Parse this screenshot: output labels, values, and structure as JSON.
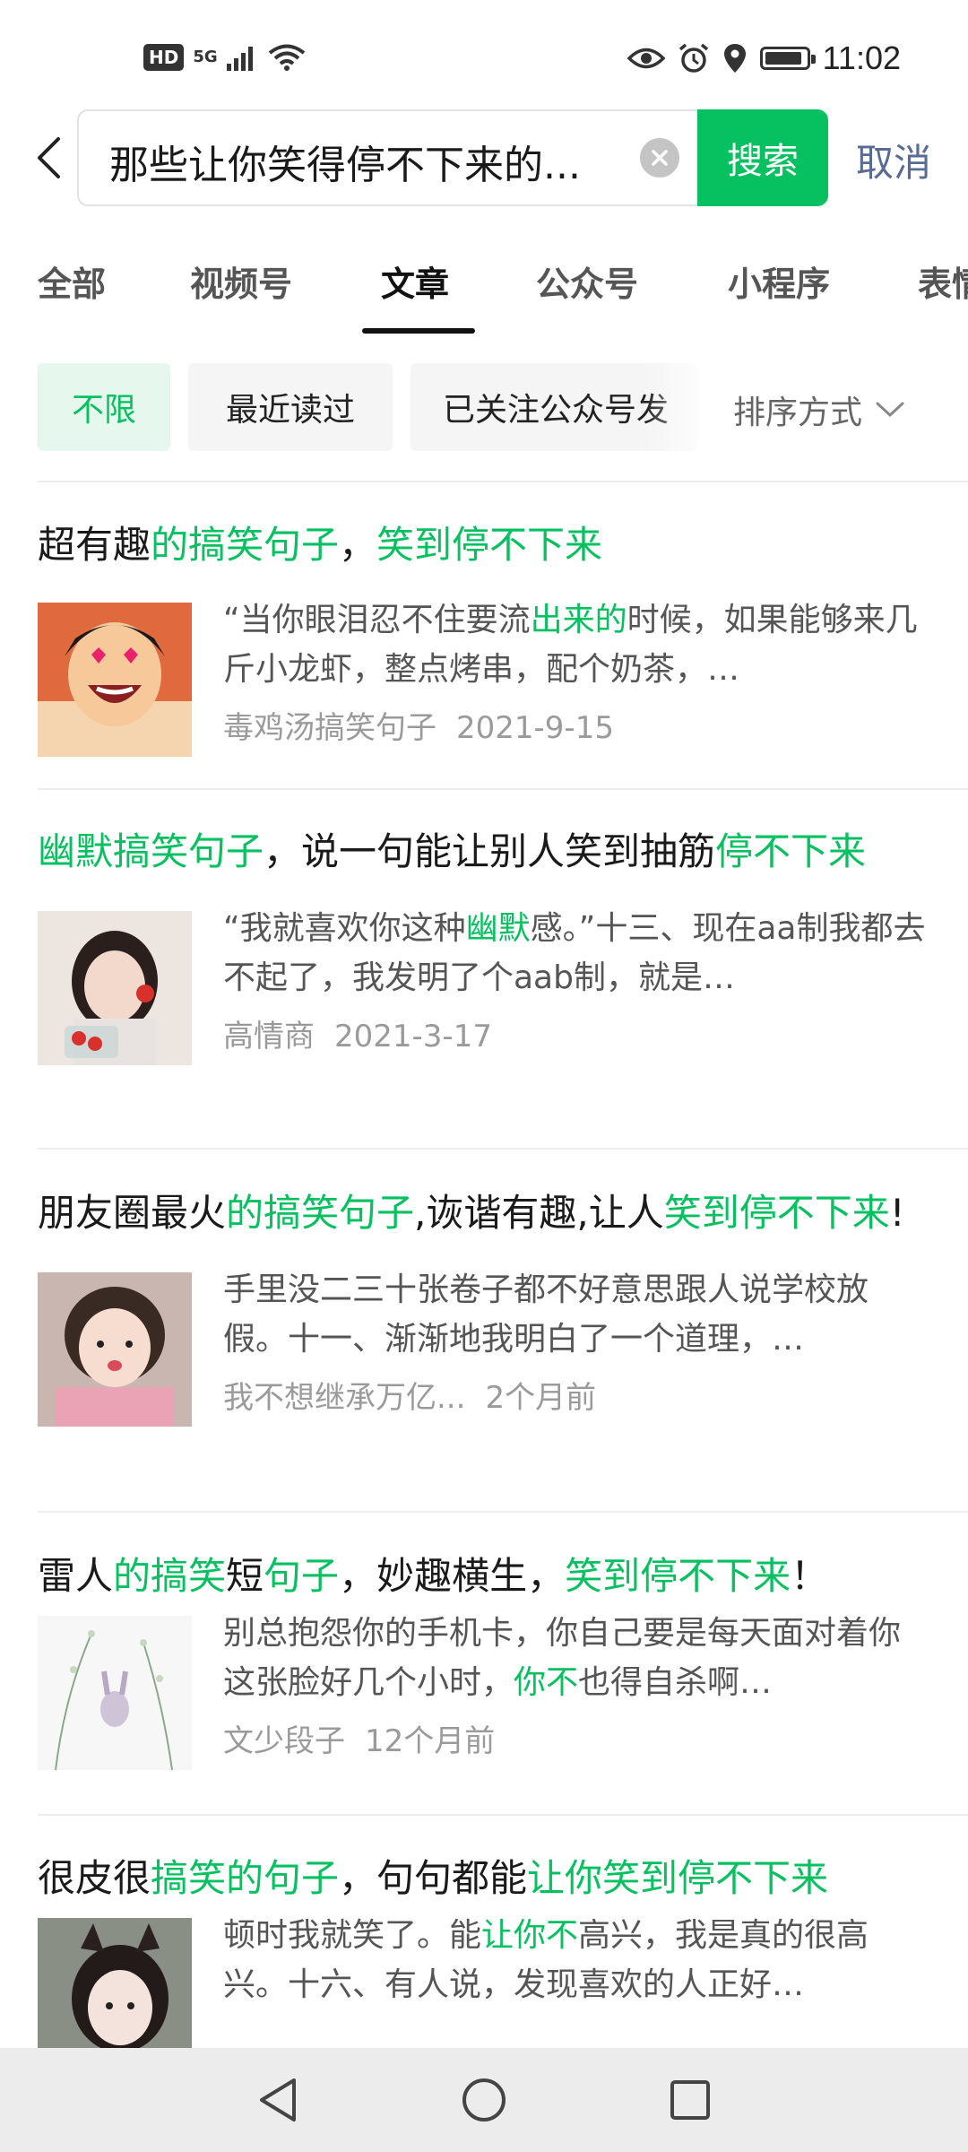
{
  "status_bar": {
    "hd": "HD",
    "network": "5G",
    "time": "11:02",
    "battery_level": 0.9
  },
  "search": {
    "query": "那些让你笑得停不下来的...",
    "button_label": "搜索",
    "cancel_label": "取消"
  },
  "tabs": [
    {
      "label": "全部"
    },
    {
      "label": "视频号"
    },
    {
      "label": "文章"
    },
    {
      "label": "公众号"
    },
    {
      "label": "小程序"
    },
    {
      "label": "表情"
    }
  ],
  "filters": {
    "chips": [
      {
        "label": "不限"
      },
      {
        "label": "最近读过"
      },
      {
        "label": "已关注公众号发"
      }
    ],
    "sort_label": "排序方式"
  },
  "results": [
    {
      "title": [
        {
          "t": "超有趣",
          "h": false
        },
        {
          "t": "的搞笑句子",
          "h": true
        },
        {
          "t": "，",
          "h": false
        },
        {
          "t": "笑到停不下来",
          "h": true
        }
      ],
      "snippet": [
        {
          "t": "“当你眼泪忍不住要流",
          "h": false
        },
        {
          "t": "出来的",
          "h": true
        },
        {
          "t": "时候，如果能够来几斤小龙虾，整点烤串，配个奶茶，…",
          "h": false
        }
      ],
      "source": "毒鸡汤搞笑句子",
      "date": "2021-9-15"
    },
    {
      "title": [
        {
          "t": "幽默搞笑句子",
          "h": true
        },
        {
          "t": "，说一句能让别人笑到抽筋",
          "h": false
        },
        {
          "t": "停不下来",
          "h": true
        }
      ],
      "snippet": [
        {
          "t": "“我就喜欢你这种",
          "h": false
        },
        {
          "t": "幽默",
          "h": true
        },
        {
          "t": "感。”十三、现在aa制我都去不起了，我发明了个aab制，就是…",
          "h": false
        }
      ],
      "source": "高情商",
      "date": "2021-3-17"
    },
    {
      "title": [
        {
          "t": "朋友圈最火",
          "h": false
        },
        {
          "t": "的搞笑句子",
          "h": true
        },
        {
          "t": ",诙谐有趣,让人",
          "h": false
        },
        {
          "t": "笑到停不下来",
          "h": true
        },
        {
          "t": "!",
          "h": false
        }
      ],
      "snippet": [
        {
          "t": "手里没二三十张卷子都不好意思跟人说学校放假。十一、渐渐地我明白了一个道理，…",
          "h": false
        }
      ],
      "source": "我不想继承万亿...",
      "date": "2个月前"
    },
    {
      "title": [
        {
          "t": "雷人",
          "h": false
        },
        {
          "t": "的搞笑",
          "h": true
        },
        {
          "t": "短",
          "h": false
        },
        {
          "t": "句子",
          "h": true
        },
        {
          "t": "，妙趣横生，",
          "h": false
        },
        {
          "t": "笑到停不下来",
          "h": true
        },
        {
          "t": "！",
          "h": false
        }
      ],
      "snippet": [
        {
          "t": "别总抱怨你的手机卡，你自己要是每天面对着你这张脸好几个小时，",
          "h": false
        },
        {
          "t": "你不",
          "h": true
        },
        {
          "t": "也得自杀啊…",
          "h": false
        }
      ],
      "source": "文少段子",
      "date": "12个月前"
    },
    {
      "title": [
        {
          "t": "很皮很",
          "h": false
        },
        {
          "t": "搞笑的句子",
          "h": true
        },
        {
          "t": "，句句都能",
          "h": false
        },
        {
          "t": "让你笑到停不下来",
          "h": true
        }
      ],
      "snippet": [
        {
          "t": "顿时我就笑了。能",
          "h": false
        },
        {
          "t": "让你不",
          "h": true
        },
        {
          "t": "高兴，我是真的很高兴。十六、有人说，发现喜欢的人正好…",
          "h": false
        }
      ],
      "source": "",
      "date": ""
    }
  ],
  "colors": {
    "accent": "#07c160",
    "link": "#576b95"
  }
}
